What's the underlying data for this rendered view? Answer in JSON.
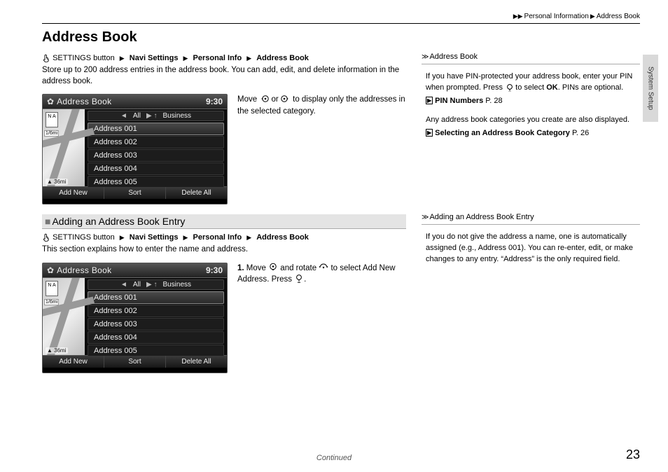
{
  "breadcrumb_top": {
    "a": "Personal Information",
    "b": "Address Book"
  },
  "title": "Address Book",
  "page_number": "23",
  "continued": "Continued",
  "side_tab": "System Setup",
  "path": {
    "prefix": "SETTINGS button",
    "a": "Navi Settings",
    "b": "Personal Info",
    "c": "Address Book"
  },
  "intro": "Store up to 200 address entries in the address book. You can add, edit, and delete information in the address book.",
  "caption1": {
    "pre": "Move ",
    "mid": " or ",
    "post": " to display only the addresses in the selected category."
  },
  "sub": {
    "title": "Adding an Address Book Entry",
    "intro": "This section explains how to enter the name and address."
  },
  "caption2": {
    "num": "1.",
    "a": " Move ",
    "b": " and rotate ",
    "c": " to select ",
    "target": "Add New Address",
    "d": ". Press ",
    "e": "."
  },
  "device": {
    "title": "Address Book",
    "time": "9:30",
    "filter": {
      "left": "All",
      "right": "Business"
    },
    "rows": [
      "Address 001",
      "Address 002",
      "Address 003",
      "Address 004",
      "Address 005"
    ],
    "footer": [
      "Add New",
      "Sort",
      "Delete All"
    ],
    "compass": "N\nA",
    "dist": "1/6mi",
    "scale": "36mi"
  },
  "notes": {
    "a": {
      "title": "Address Book",
      "p1_a": "If you have PIN-protected your address book, enter your PIN when prompted. Press ",
      "p1_b": " to select ",
      "ok": "OK",
      "p1_c": ". PINs are optional.",
      "xref1": {
        "label": "PIN Numbers",
        "page": "P. 28"
      },
      "p2": "Any address book categories you create are also displayed.",
      "xref2": {
        "label": "Selecting an Address Book Category",
        "page": "P. 26"
      }
    },
    "b": {
      "title": "Adding an Address Book Entry",
      "p": "If you do not give the address a name, one is automatically assigned (e.g., Address 001). You can re-enter, edit, or make changes to any entry. “Address” is the only required field."
    }
  }
}
